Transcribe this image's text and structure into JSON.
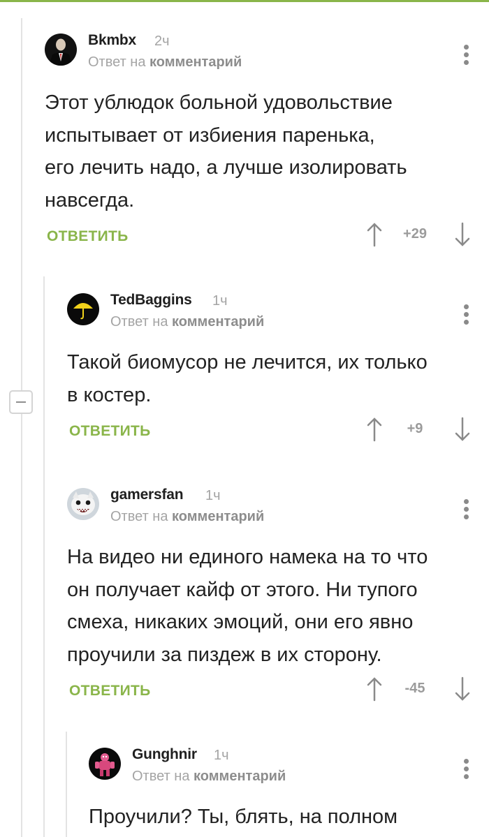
{
  "colors": {
    "accent": "#8ab54a",
    "meta_text": "#a4a4a4",
    "vote_text": "#9b9b9b"
  },
  "reply_prefix": "Ответ на",
  "reply_target": "комментарий",
  "comments": [
    {
      "author": "Bkmbx",
      "time": "2ч",
      "avatar_icon": "hitman-avatar-icon",
      "text": "Этот ублюдок больной удовольствие\nиспытывает от избиения паренька,\nего лечить надо, а лучше изолировать\nнавсегда.",
      "reply_label": "ОТВЕТИТЬ",
      "votes": "+29"
    },
    {
      "author": "TedBaggins",
      "time": "1ч",
      "avatar_icon": "yellow-umbrella-avatar-icon",
      "text": "Такой биомусор не лечится, их только\nв костер.",
      "reply_label": "ОТВЕТИТЬ",
      "votes": "+9"
    },
    {
      "author": "gamersfan",
      "time": "1ч",
      "avatar_icon": "white-creature-avatar-icon",
      "text": "На видео ни единого намека на то что\nон получает кайф от этого. Ни тупого\nсмеха, никаких эмоций, они его явно\nпроучили за пиздеж в их сторону.",
      "reply_label": "ОТВЕТИТЬ",
      "votes": "-45"
    },
    {
      "author": "Gunghnir",
      "time": "1ч",
      "avatar_icon": "pink-monster-avatar-icon",
      "text": "Проучили? Ты, блять, на полном",
      "reply_label": "",
      "votes": ""
    }
  ]
}
